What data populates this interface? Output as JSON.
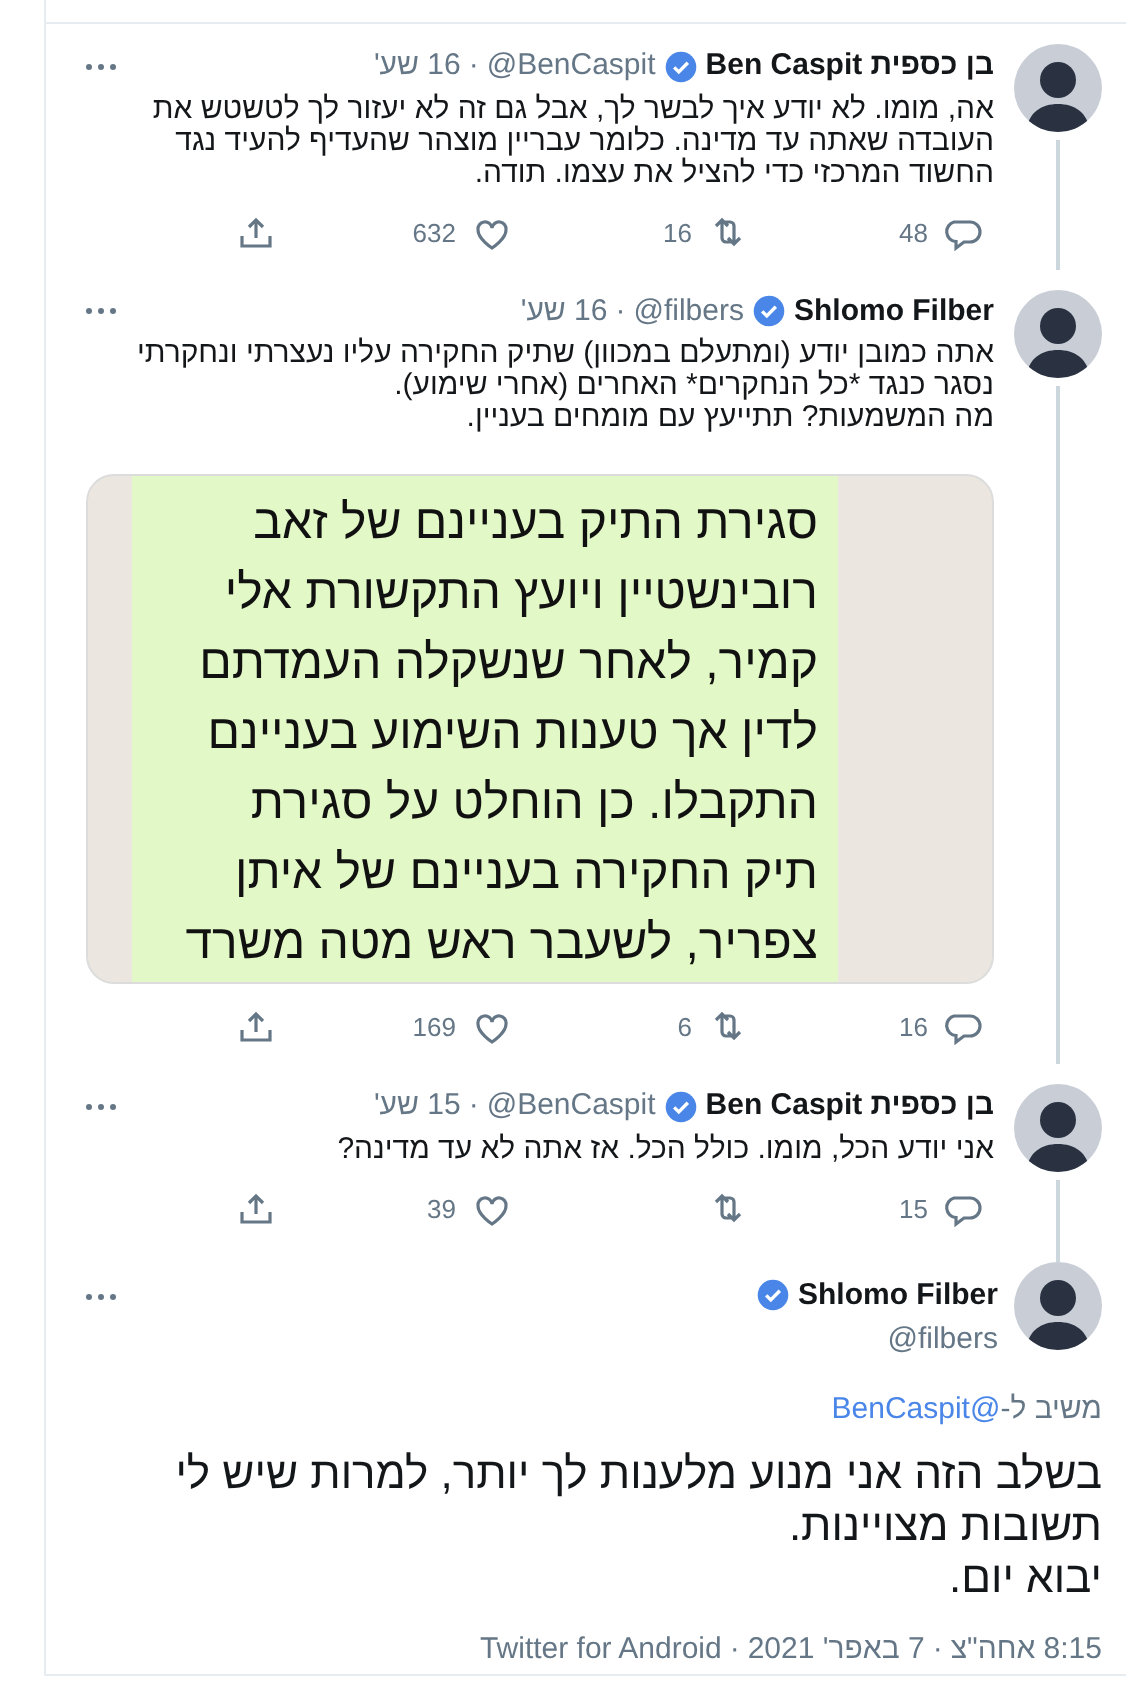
{
  "tweets": [
    {
      "name": "בן כספית Ben Caspit",
      "verified": true,
      "handle": "@BenCaspit",
      "time": "16 שע'",
      "text": "אה, מומו. לא יודע איך לבשר לך, אבל גם זה לא יעזור לך לטשטש את העובדה שאתה עד מדינה. כלומר עבריין מוצהר שהעדיף להעיד נגד החשוד המרכזי כדי להציל את עצמו. תודה.",
      "replies": "48",
      "retweets": "16",
      "likes": "632"
    },
    {
      "name": "Shlomo Filber",
      "verified": true,
      "handle": "@filbers",
      "time": "16 שע'",
      "text": "אתה כמובן יודע (ומתעלם במכוון) שתיק החקירה עליו נעצרתי ונחקרתי נסגר כנגד *כל הנחקרים* האחרים (אחרי שימוע).\nמה המשמעות? תתייעץ עם מומחים בעניין.",
      "image_lines": [
        "סגירת התיק בעניינם של זאב",
        "רובינשטיין ויועץ התקשורת אלי",
        "קמיר, לאחר שנשקלה העמדתם",
        "לדין אך טענות השימוע בעניינם",
        "התקבלו. כן הוחלט על סגירת",
        "תיק החקירה בעניינם של איתן",
        "צפריר, לשעבר ראש מטה משרד"
      ],
      "replies": "16",
      "retweets": "6",
      "likes": "169"
    },
    {
      "name": "בן כספית Ben Caspit",
      "verified": true,
      "handle": "@BenCaspit",
      "time": "15 שע'",
      "text": "אני יודע הכל, מומו. כולל הכל. אז אתה לא עד מדינה?",
      "replies": "15",
      "likes": "39"
    }
  ],
  "main_tweet": {
    "name": "Shlomo Filber",
    "verified": true,
    "handle": "@filbers",
    "replying_label": "משיב ל-",
    "replying_to": "@BenCaspit",
    "text": "בשלב הזה אני מנוע מלענות לך יותר, למרות שיש לי תשובות מצויינות.\nיבוא יום.",
    "meta": [
      "8:15 אחה\"צ",
      "7 באפר' 2021",
      "Twitter for Android"
    ]
  },
  "separator": "·"
}
